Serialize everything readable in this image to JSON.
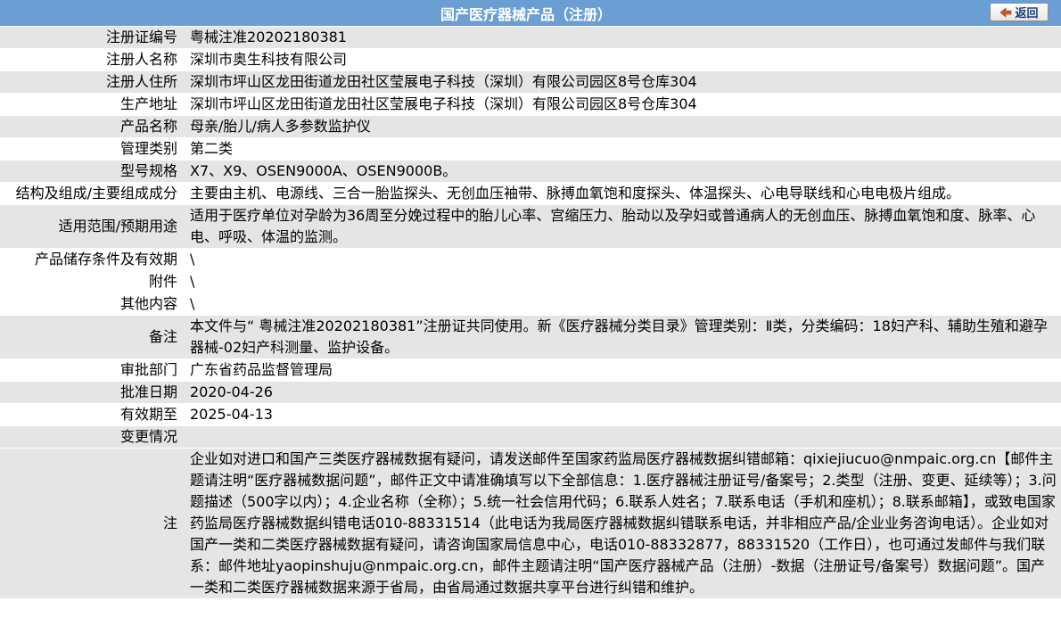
{
  "header": {
    "title": "国产医疗器械产品（注册）",
    "back_label": "返回"
  },
  "rows": {
    "reg_no": {
      "label": "注册证编号",
      "value": "粤械注准20202180381"
    },
    "registrant": {
      "label": "注册人名称",
      "value": "深圳市奥生科技有限公司"
    },
    "registrant_addr": {
      "label": "注册人住所",
      "value": "深圳市坪山区龙田街道龙田社区莹展电子科技（深圳）有限公司园区8号仓库304"
    },
    "prod_addr": {
      "label": "生产地址",
      "value": "深圳市坪山区龙田街道龙田社区莹展电子科技（深圳）有限公司园区8号仓库304"
    },
    "product_name": {
      "label": "产品名称",
      "value": "母亲/胎儿/病人多参数监护仪"
    },
    "mgmt_class": {
      "label": "管理类别",
      "value": "第二类"
    },
    "model": {
      "label": "型号规格",
      "value": "X7、X9、OSEN9000A、OSEN9000B。"
    },
    "structure": {
      "label": "结构及组成/主要组成成分",
      "value": "主要由主机、电源线、三合一胎监探头、无创血压袖带、脉搏血氧饱和度探头、体温探头、心电导联线和心电电极片组成。"
    },
    "scope": {
      "label": "适用范围/预期用途",
      "value": "适用于医疗单位对孕龄为36周至分娩过程中的胎儿心率、宫缩压力、胎动以及孕妇或普通病人的无创血压、脉搏血氧饱和度、脉率、心电、呼吸、体温的监测。"
    },
    "storage": {
      "label": "产品储存条件及有效期",
      "value": "\\"
    },
    "attachment": {
      "label": "附件",
      "value": "\\"
    },
    "other": {
      "label": "其他内容",
      "value": "\\"
    },
    "remark": {
      "label": "备注",
      "value": "本文件与“ 粤械注准20202180381”注册证共同使用。新《医疗器械分类目录》管理类别：Ⅱ类，分类编码：18妇产科、辅助生殖和避孕器械-02妇产科测量、监护设备。"
    },
    "dept": {
      "label": "审批部门",
      "value": "广东省药品监督管理局"
    },
    "approve_date": {
      "label": "批准日期",
      "value": "2020-04-26"
    },
    "valid_until": {
      "label": "有效期至",
      "value": "2025-04-13"
    },
    "change": {
      "label": "变更情况",
      "value": ""
    },
    "note": {
      "label": "注",
      "value": "企业如对进口和国产三类医疗器械数据有疑问，请发送邮件至国家药监局医疗器械数据纠错邮箱：qixiejiucuo@nmpaic.org.cn【邮件主题请注明“医疗器械数据问题”，邮件正文中请准确填写以下全部信息：1.医疗器械注册证号/备案号；2.类型（注册、变更、延续等）；3.问题描述（500字以内）；4.企业名称（全称）；5.统一社会信用代码；6.联系人姓名；7.联系电话（手机和座机）；8.联系邮箱】，或致电国家药监局医疗器械数据纠错电话010-88331514（此电话为我局医疗器械数据纠错联系电话，并非相应产品/企业业务咨询电话）。企业如对国产一类和二类医疗器械数据有疑问，请咨询国家局信息中心，电话010-88332877，88331520（工作日），也可通过发邮件与我们联系：邮件地址yaopinshuju@nmpaic.org.cn，邮件主题请注明“国产医疗器械产品（注册）-数据（注册证号/备案号）数据问题”。国产一类和二类医疗器械数据来源于省局，由省局通过数据共享平台进行纠错和维护。"
    }
  },
  "colors": {
    "header_bg": "#6b9fd3",
    "row_dark": "#e5e5e5",
    "row_light": "#ffffff",
    "back_text": "#1a3f7a",
    "back_arrow": "#d9531e"
  },
  "icons": {
    "back": "back-arrow-icon"
  }
}
